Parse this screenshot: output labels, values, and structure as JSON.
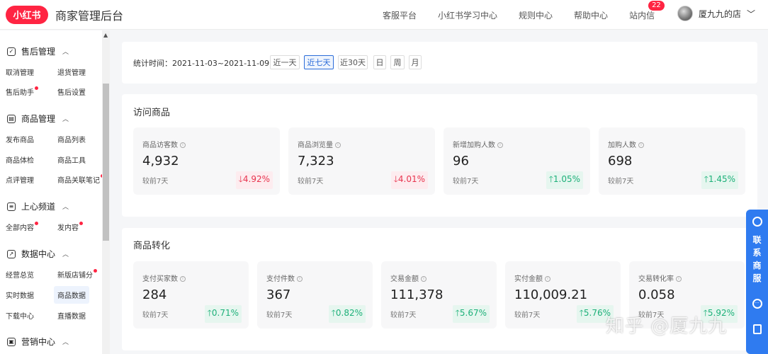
{
  "header": {
    "logo": "小红书",
    "title": "商家管理后台",
    "nav": [
      "客服平台",
      "小红书学习中心",
      "规则中心",
      "帮助中心",
      "站内信"
    ],
    "inbox_badge": "22",
    "user_name": "厦九九的店"
  },
  "sidebar": {
    "groups": [
      {
        "title": "售后管理",
        "items": [
          "取消管理",
          "退货管理",
          "售后助手",
          "售后设置"
        ]
      },
      {
        "title": "商品管理",
        "items": [
          "发布商品",
          "商品列表",
          "商品体检",
          "商品工具",
          "点评管理",
          "商品关联笔记"
        ]
      },
      {
        "title": "上心频道",
        "items": [
          "全部内容",
          "发内容"
        ]
      },
      {
        "title": "数据中心",
        "items": [
          "经营总览",
          "新版店铺分",
          "实时数据",
          "商品数据",
          "下载中心",
          "直播数据"
        ]
      },
      {
        "title": "营销中心"
      }
    ]
  },
  "filter": {
    "label": "统计时间：2021-11-03~2021-11-09",
    "buttons": [
      "近一天",
      "近七天",
      "近30天",
      "日",
      "周",
      "月"
    ],
    "active": "近七天"
  },
  "visit": {
    "title": "访问商品",
    "metrics": [
      {
        "label": "商品访客数",
        "value": "4,932",
        "compare": "较前7天",
        "change": "4.92%",
        "direction": "down"
      },
      {
        "label": "商品浏览量",
        "value": "7,323",
        "compare": "较前7天",
        "change": "4.01%",
        "direction": "down"
      },
      {
        "label": "新增加购人数",
        "value": "96",
        "compare": "较前7天",
        "change": "1.05%",
        "direction": "up"
      },
      {
        "label": "加购人数",
        "value": "698",
        "compare": "较前7天",
        "change": "1.45%",
        "direction": "up"
      }
    ]
  },
  "conversion": {
    "title": "商品转化",
    "metrics": [
      {
        "label": "支付买家数",
        "value": "284",
        "compare": "较前7天",
        "change": "0.71%",
        "direction": "up"
      },
      {
        "label": "支付件数",
        "value": "367",
        "compare": "较前7天",
        "change": "0.82%",
        "direction": "up"
      },
      {
        "label": "交易金额",
        "value": "111,378",
        "compare": "较前7天",
        "change": "5.67%",
        "direction": "up"
      },
      {
        "label": "实付金额",
        "value": "110,009.21",
        "compare": "较前7天",
        "change": "5.76%",
        "direction": "up"
      },
      {
        "label": "交易转化率",
        "value": "0.058",
        "compare": "较前7天",
        "change": "5.92%",
        "direction": "up"
      }
    ]
  },
  "service": {
    "label": "联系商服"
  },
  "watermark": "知乎 @厦九九",
  "colors": {
    "brand": "#ff2442",
    "accent": "#2b6cd9",
    "down": "#e8344e",
    "up": "#1db079"
  }
}
